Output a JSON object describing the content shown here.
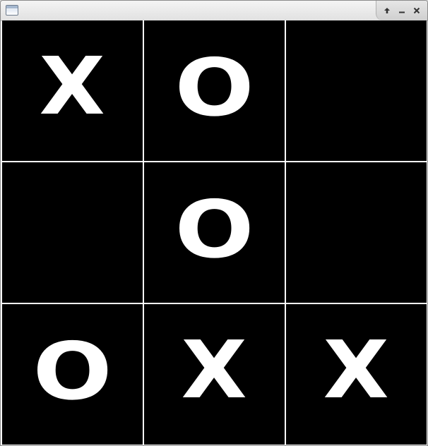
{
  "window": {
    "icon": "window-app-icon",
    "controls": [
      "maximize-icon",
      "minimize-icon",
      "close-icon"
    ]
  },
  "board": {
    "cells": [
      {
        "mark": "X"
      },
      {
        "mark": "O"
      },
      {
        "mark": ""
      },
      {
        "mark": ""
      },
      {
        "mark": "O"
      },
      {
        "mark": ""
      },
      {
        "mark": "O"
      },
      {
        "mark": "X"
      },
      {
        "mark": "X"
      }
    ],
    "colors": {
      "background": "#000000",
      "mark": "#ffffff",
      "grid": "#ffffff"
    }
  }
}
